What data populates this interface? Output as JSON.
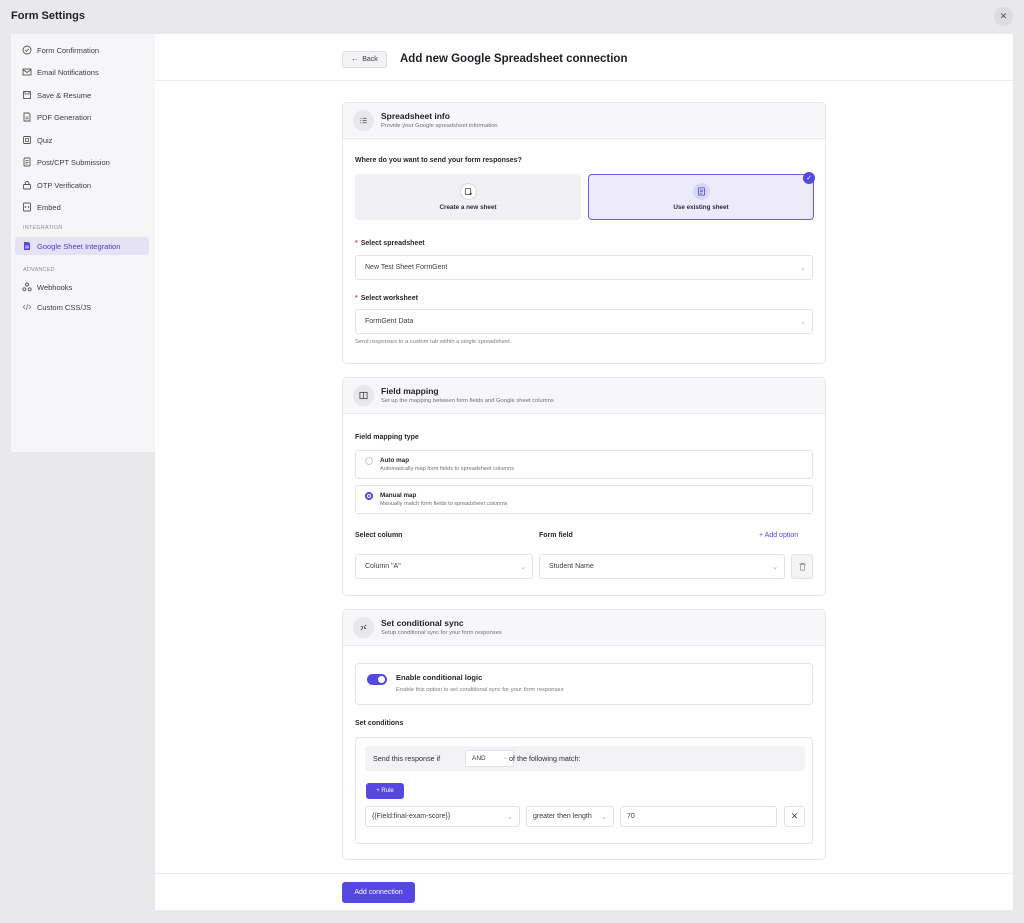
{
  "window": {
    "title": "Form Settings"
  },
  "sidebar": {
    "items": [
      {
        "label": "Form Confirmation",
        "icon": "check-circle-icon"
      },
      {
        "label": "Email Notifications",
        "icon": "mail-icon"
      },
      {
        "label": "Save & Resume",
        "icon": "save-icon"
      },
      {
        "label": "PDF Generation",
        "icon": "pdf-icon"
      },
      {
        "label": "Quiz",
        "icon": "quiz-icon"
      },
      {
        "label": "Post/CPT Submission",
        "icon": "document-icon"
      },
      {
        "label": "OTP Verification",
        "icon": "lock-icon"
      },
      {
        "label": "Embed",
        "icon": "embed-icon"
      }
    ],
    "section_integration": "INTEGRATION",
    "integration_item": {
      "label": "Google Sheet Integration",
      "icon": "sheet-icon"
    },
    "section_advanced": "ADVANCED",
    "advanced_items": [
      {
        "label": "Webhooks",
        "icon": "webhook-icon"
      },
      {
        "label": "Custom CSS/JS",
        "icon": "code-icon"
      }
    ]
  },
  "header": {
    "back_label": "Back",
    "title": "Add new Google Spreadsheet connection"
  },
  "spreadsheet_info": {
    "title": "Spreadsheet info",
    "subtitle": "Provide your Google spreadsheet information",
    "question": "Where do you want to send your form responses?",
    "create_label": "Create a new sheet",
    "existing_label": "Use existing sheet",
    "spreadsheet_label": "Select spreadsheet",
    "spreadsheet_value": "New Test Sheet FormGent",
    "worksheet_label": "Select worksheet",
    "worksheet_value": "FormGent Data",
    "worksheet_hint": "Send responses to a custom tab within a single spreadsheet."
  },
  "field_mapping": {
    "title": "Field mapping",
    "subtitle": "Set up the mapping between form fields and Google sheet columns",
    "type_label": "Field mapping type",
    "auto_title": "Auto map",
    "auto_sub": "Automatically map form fields to spreadsheet columns",
    "manual_title": "Manual map",
    "manual_sub": "Manually match form fields to spreadsheet columns",
    "col_header": "Select column",
    "field_header": "Form field",
    "add_option": "Add option",
    "column_value": "Column \"A\"",
    "field_value": "Student Name"
  },
  "conditional_sync": {
    "title": "Set conditional sync",
    "subtitle": "Setup conditional sync for your form responses",
    "toggle_title": "Enable conditional logic",
    "toggle_sub": "Enable this option to set conditional sync for your form responses",
    "conditions_label": "Set conditions",
    "send_prefix": "Send this response if",
    "operator": "AND",
    "send_suffix": "of the following match:",
    "rule_button": "+ Rule",
    "rule_field": "{{Field:final-exam-score}}",
    "rule_comparator": "greater then length",
    "rule_value": "70"
  },
  "footer": {
    "add_connection": "Add connection"
  },
  "colors": {
    "accent": "#5448e0",
    "accent_soft": "#eceafb"
  }
}
